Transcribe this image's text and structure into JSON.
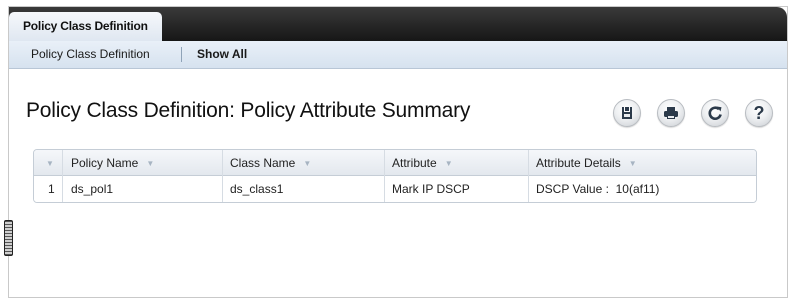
{
  "tabs": [
    {
      "label": "Policy Class Definition",
      "active": true
    }
  ],
  "subnav": {
    "items": [
      "Policy Class Definition",
      "Show All"
    ]
  },
  "page": {
    "title": "Policy Class Definition: Policy Attribute Summary"
  },
  "toolbar": {
    "buttons": [
      {
        "icon": "save-icon"
      },
      {
        "icon": "print-icon"
      },
      {
        "icon": "refresh-icon"
      },
      {
        "icon": "help-icon",
        "glyph": "?"
      }
    ]
  },
  "table": {
    "columns": [
      "Policy Name",
      "Class Name",
      "Attribute",
      "Attribute Details"
    ],
    "rows": [
      {
        "index": "1",
        "policy_name": "ds_pol1",
        "class_name": "ds_class1",
        "attribute": "Mark IP DSCP",
        "attribute_details": "DSCP Value :  10(af11)"
      }
    ]
  },
  "colors": {
    "tabbar": "#161616",
    "subnav": "#d6e2ef",
    "grid_border": "#c5cdd6"
  }
}
